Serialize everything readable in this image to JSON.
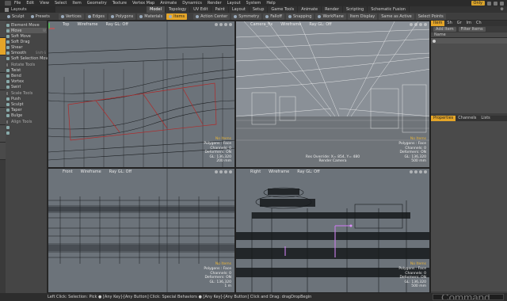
{
  "menu": {
    "items": [
      "File",
      "Edit",
      "View",
      "Select",
      "Item",
      "Geometry",
      "Texture",
      "Vertex Map",
      "Animate",
      "Dynamics",
      "Render",
      "Layout",
      "System",
      "Help"
    ],
    "help_label": "Only"
  },
  "layout_label": "Layouts",
  "tabs": [
    "Model",
    "Topology",
    "UV Edit",
    "Paint",
    "Layout",
    "Setup",
    "Game Tools",
    "Animate",
    "Render",
    "Scripting",
    "Schematic Fusion"
  ],
  "toolbar": {
    "items": [
      "Sculpt",
      "Presets",
      "Vertices",
      "Edges",
      "Polygons",
      "Materials",
      "Items",
      "Action Center",
      "Symmetry",
      "Falloff",
      "Snapping",
      "WorkPlane",
      "Item Display",
      "Same as Active",
      "Select Points"
    ],
    "active_index": 6
  },
  "tools": [
    {
      "label": "Element Move",
      "shortcut": "",
      "header": false
    },
    {
      "label": "Move",
      "shortcut": "W",
      "header": false
    },
    {
      "label": "Soft Move",
      "shortcut": "",
      "header": false
    },
    {
      "label": "Soft Drag",
      "shortcut": "",
      "header": false
    },
    {
      "label": "Shear",
      "shortcut": "",
      "header": false
    },
    {
      "label": "Smooth",
      "shortcut": "Shift-S",
      "header": false
    },
    {
      "label": "Soft Selection Move",
      "shortcut": "",
      "header": false
    },
    {
      "label": "Rotate Tools",
      "shortcut": "",
      "header": true
    },
    {
      "label": "Twist",
      "shortcut": "",
      "header": false
    },
    {
      "label": "Bend",
      "shortcut": "",
      "header": false
    },
    {
      "label": "Vortex",
      "shortcut": "",
      "header": false
    },
    {
      "label": "Swirl",
      "shortcut": "",
      "header": false
    },
    {
      "label": "Scale Tools",
      "shortcut": "",
      "header": true
    },
    {
      "label": "Push",
      "shortcut": "",
      "header": false
    },
    {
      "label": "Sculpt",
      "shortcut": "",
      "header": false
    },
    {
      "label": "Taper",
      "shortcut": "",
      "header": false
    },
    {
      "label": "Bulge",
      "shortcut": "",
      "header": false
    },
    {
      "label": "Align Tools",
      "shortcut": "",
      "header": true
    },
    {
      "label": "",
      "shortcut": "",
      "header": false
    },
    {
      "label": "",
      "shortcut": "",
      "header": false
    }
  ],
  "viewports": {
    "top": {
      "view": "Top",
      "shading": "Wireframe",
      "gl": "Ray GL: Off",
      "info": [
        "No Items",
        "Polygons : Face",
        "Channels: 0",
        "Deformers: ON",
        "GL: 136,320",
        "200 mm"
      ]
    },
    "camera": {
      "view": "Camera_fix",
      "shading": "Wireframe",
      "gl": "Ray GL: Off",
      "center": [
        "Res Override: X= 854, Y= 480",
        "Render Camera"
      ],
      "info": [
        "No Items",
        "Polygons : Face",
        "Channels: 0",
        "Deformers: ON",
        "GL: 136,320",
        "500 mm"
      ]
    },
    "front": {
      "view": "Front",
      "shading": "Wireframe",
      "gl": "Ray GL: Off",
      "info": [
        "No Items",
        "Polygons : Face",
        "Channels: 0",
        "Deformers: ON",
        "GL: 136,320",
        "1 m"
      ]
    },
    "right": {
      "view": "Right",
      "shading": "Wireframe",
      "gl": "Ray GL: Off",
      "info": [
        "No Items",
        "Polygons : Face",
        "Channels: 0",
        "Deformers: ON",
        "GL: 136,320",
        "500 mm"
      ]
    }
  },
  "right_panel": {
    "tabs": [
      "Item",
      "Sh",
      "Gr",
      "Im",
      "Ch"
    ],
    "add_item": "Add Item",
    "filter": "Filter Items",
    "column": "Name",
    "tabs2": [
      "Properties",
      "Channels",
      "Lists"
    ]
  },
  "status": {
    "text": "Left Click: Selection: Pick ● [Any Key]-[Any Button] Click: Special Behaviors ● [Any Key]-[Any Button] Click and Drag: dragDropBegin",
    "command_placeholder": "Command"
  }
}
